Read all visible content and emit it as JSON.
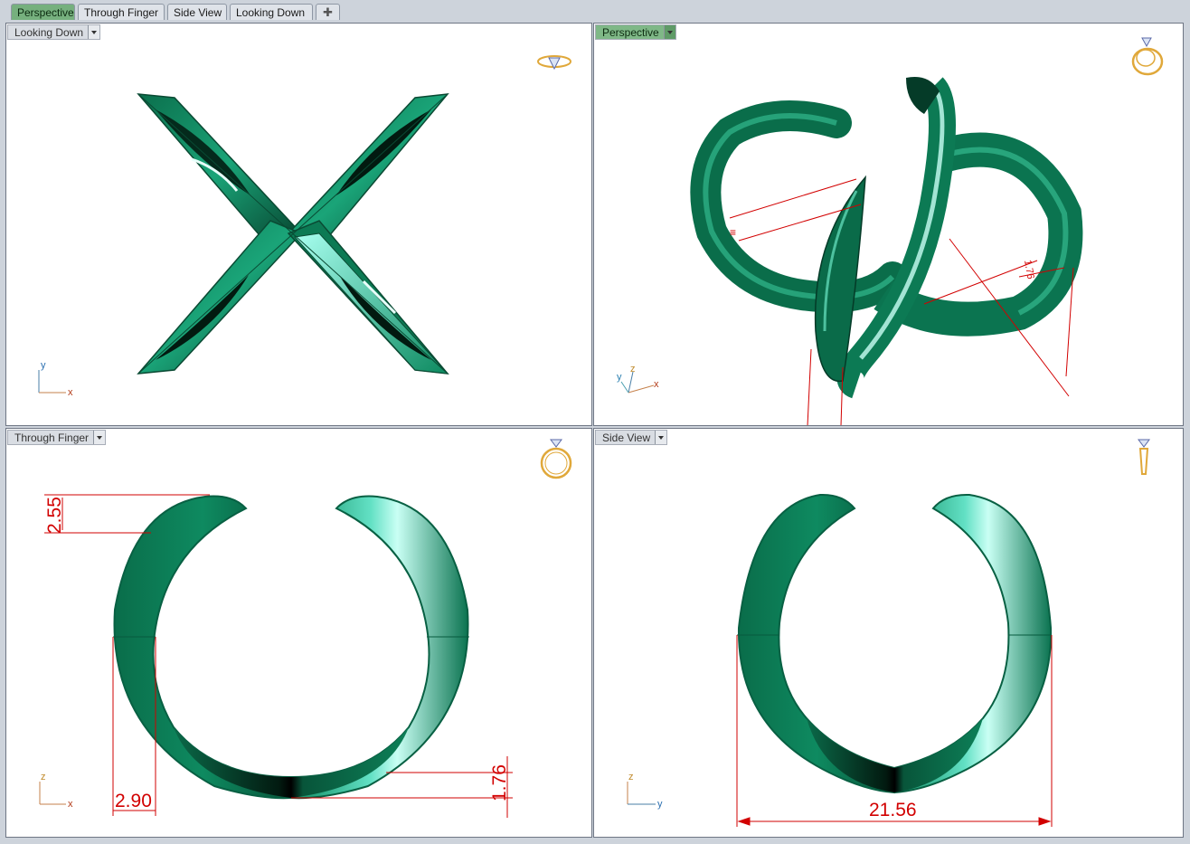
{
  "tabs": [
    {
      "label": "Perspective",
      "active": true
    },
    {
      "label": "Through Finger",
      "active": false
    },
    {
      "label": "Side View",
      "active": false
    },
    {
      "label": "Looking Down",
      "active": false
    }
  ],
  "add_tab_icon": "plus-icon",
  "viewports": {
    "top_left": {
      "label": "Looking Down",
      "active": false,
      "axes": [
        "y",
        "x"
      ],
      "thumb_icon": "ring-top-icon"
    },
    "top_right": {
      "label": "Perspective",
      "active": true,
      "axes": [
        "y",
        "z",
        "x"
      ],
      "thumb_icon": "ring-perspective-icon"
    },
    "bottom_left": {
      "label": "Through Finger",
      "active": false,
      "axes": [
        "z",
        "x"
      ],
      "thumb_icon": "ring-front-icon"
    },
    "bottom_right": {
      "label": "Side View",
      "active": false,
      "axes": [
        "z",
        "y"
      ],
      "thumb_icon": "ring-side-icon"
    }
  },
  "dimensions": {
    "top_gap": "2.55",
    "side_thickness": "2.90",
    "bottom_thickness": "1.76",
    "width": "21.56",
    "persp_dim": "1.76"
  },
  "colors": {
    "ring_green": "#0e7f59",
    "ring_dark": "#043a27",
    "ring_highlight": "#b8fff0",
    "dimension_red": "#d20000",
    "active_tab": "#76b07e"
  }
}
